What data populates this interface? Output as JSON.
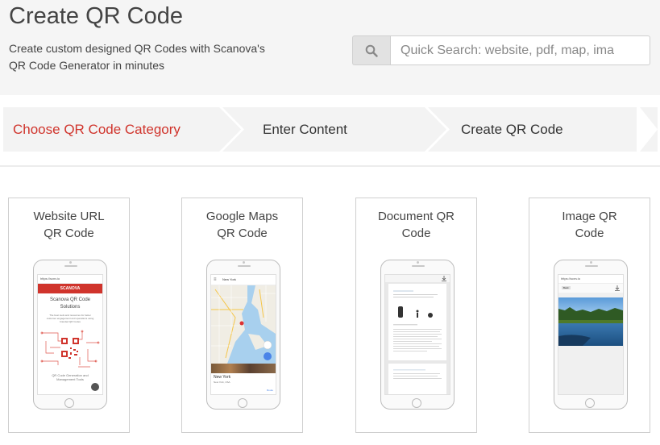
{
  "header": {
    "title": "Create QR Code",
    "subtitle": "Create custom designed QR Codes with Scanova's QR Code Generator in minutes"
  },
  "search": {
    "icon": "search-icon",
    "placeholder": "Quick Search: website, pdf, map, ima"
  },
  "steps": [
    {
      "label": "Choose QR Code Category",
      "active": true
    },
    {
      "label": "Enter Content",
      "active": false
    },
    {
      "label": "Create QR Code",
      "active": false
    }
  ],
  "colors": {
    "accent": "#d0342c",
    "map_blue": "#a8d0ee",
    "map_land": "#f0ede4"
  },
  "cards": [
    {
      "title_line1": "Website URL",
      "title_line2": "QR Code",
      "preview": {
        "url": "https://scnv.io",
        "brand": "SCANOVA",
        "heading_line1": "Scanova QR Code",
        "heading_line2": "Solutions",
        "body_line1": "The best tools and resources for better",
        "body_line2": "customer engagement and operations using",
        "body_line3": "branded QR Codes",
        "footer_line1": "QR Code Generation and",
        "footer_line2": "Management Tools"
      }
    },
    {
      "title_line1": "Google Maps",
      "title_line2": "QR Code",
      "preview": {
        "search_text": "New York",
        "place_name": "New York",
        "place_sub": "New York, USA",
        "route": "Route"
      }
    },
    {
      "title_line1": "Document QR",
      "title_line2": "Code",
      "preview": {}
    },
    {
      "title_line1": "Image QR",
      "title_line2": "Code",
      "preview": {
        "url": "https://scnv.io",
        "back": "Back"
      }
    }
  ]
}
